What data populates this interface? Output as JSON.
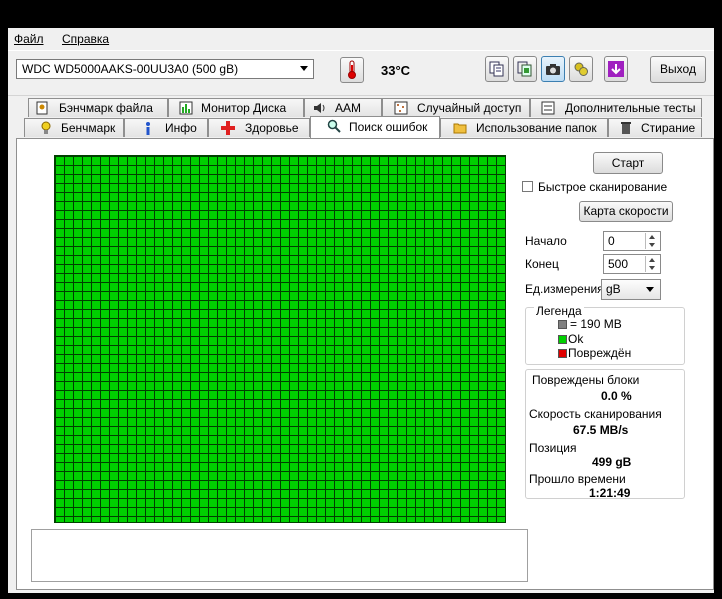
{
  "menu": {
    "file": "Файл",
    "help": "Справка"
  },
  "toolbar": {
    "drive": "WDC WD5000AAKS-00UU3A0 (500 gB)",
    "temperature": "33°C",
    "exit_label": "Выход",
    "tool_icons": [
      "copy-text-icon",
      "copy-info-icon",
      "screenshot-camera-icon",
      "settings-tools-icon",
      "download-arrow-icon"
    ]
  },
  "tabs_top": [
    {
      "label": "Бэнчмарк файла",
      "icon": "file-benchmark-icon"
    },
    {
      "label": "Монитор Диска",
      "icon": "disk-monitor-icon"
    },
    {
      "label": "AAM",
      "icon": "speaker-icon"
    },
    {
      "label": "Случайный доступ",
      "icon": "random-access-icon"
    },
    {
      "label": "Дополнительные  тесты",
      "icon": "extra-tests-icon"
    }
  ],
  "tabs_bottom": [
    {
      "label": "Бенчмарк",
      "icon": "benchmark-bulb-icon"
    },
    {
      "label": "Инфо",
      "icon": "info-icon"
    },
    {
      "label": "Здоровье",
      "icon": "health-cross-icon"
    },
    {
      "label": "Поиск ошибок",
      "icon": "magnifier-icon",
      "active": true
    },
    {
      "label": "Использование папок",
      "icon": "folder-icon"
    },
    {
      "label": "Стирание",
      "icon": "trash-icon"
    }
  ],
  "scan": {
    "start_label": "Старт",
    "quick_scan_label": "Быстрое сканирование",
    "quick_scan_checked": false,
    "speed_map_label": "Карта скорости",
    "start_field_label": "Начало",
    "start_value": "0",
    "end_field_label": "Конец",
    "end_value": "500",
    "unit_label": "Ед.измерения",
    "unit_value": "gB"
  },
  "legend": {
    "title": "Легенда",
    "block_size": "= 190 MB",
    "ok": "Ok",
    "damaged": "Повреждён",
    "colors": {
      "block": "#808080",
      "ok": "#00d000",
      "damaged": "#e00000"
    }
  },
  "stats": {
    "damaged_blocks_label": "Повреждены блоки",
    "damaged_blocks_value": "0.0 %",
    "scan_speed_label": "Скорость сканирования",
    "scan_speed_value": "67.5 MB/s",
    "position_label": "Позиция",
    "position_value": "499 gB",
    "elapsed_label": "Прошло времени",
    "elapsed_value": "1:21:49"
  },
  "grid_status": "all-ok"
}
